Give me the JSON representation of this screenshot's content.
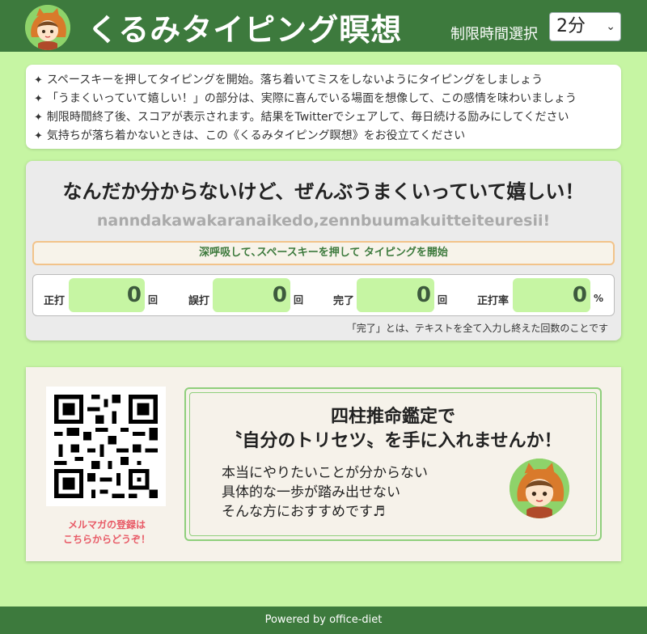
{
  "header": {
    "title": "くるみタイピング瞑想",
    "time_label": "制限時間選択",
    "time_selected": "2分"
  },
  "instructions": [
    "スペースキーを押してタイピングを開始。落ち着いてミスをしないようにタイピングをしましょう",
    "「うまくいっていて嬉しい！」の部分は、実際に喜んでいる場面を想像して、この感情を味わいましょう",
    "制限時間終了後、スコアが表示されます。結果をTwitterでシェアして、毎日続ける励みにしてください",
    "気持ちが落ち着かないときは、この《くるみタイピング瞑想》をお役立てください"
  ],
  "instruction_bullet": "✦",
  "typing": {
    "prompt": "なんだか分からないけど、ぜんぶうまくいっていて嬉しい！",
    "romaji": "nanndakawakaranaikedo,zennbuumakuitteiteuresii!",
    "start_message": "深呼吸して､スペースキーを押して タイピングを開始",
    "stats": [
      {
        "label": "正打",
        "value": "0",
        "unit": "回"
      },
      {
        "label": "誤打",
        "value": "0",
        "unit": "回"
      },
      {
        "label": "完了",
        "value": "0",
        "unit": "回"
      },
      {
        "label": "正打率",
        "value": "0",
        "unit": "%"
      }
    ],
    "note": "「完了」とは、テキストを全て入力し終えた回数のことです"
  },
  "banner": {
    "qr_caption_line1": "メルマガの登録は",
    "qr_caption_line2": "こちらからどうぞ！",
    "title_line1": "四柱推命鑑定で",
    "title_line2": "〝自分のトリセツ〟を手に入れませんか！",
    "body_line1": "本当にやりたいことが分からない",
    "body_line2": "具体的な一歩が踏み出せない",
    "body_line3": "そんな方におすすめです♬"
  },
  "footer": {
    "text": "Powered by office-diet"
  },
  "colors": {
    "background": "#c6f5a3",
    "header": "#3d7a3d",
    "accent_orange": "#f2c38a",
    "caption_pink": "#e85a66"
  }
}
